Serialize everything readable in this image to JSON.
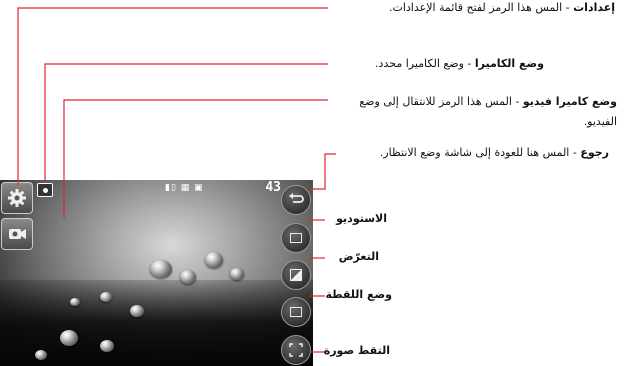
{
  "callouts": {
    "settings": {
      "bold": "إعدادات",
      "text": " - المس هذا الرمز لفتح قائمة الإعدادات."
    },
    "camera_mode": {
      "bold": "وضع الكاميرا",
      "text": " - وضع الكاميرا محدد."
    },
    "video_mode": {
      "bold": "وضع كاميرا فيديو",
      "text": " - المس هذا الرمز للانتقال إلى وضع الفيديو."
    },
    "back": {
      "bold": "رجوع",
      "text": " - المس هنا للعودة إلى شاشة وضع الانتظار."
    },
    "studio": {
      "bold": "الاستوديو",
      "text": ""
    },
    "exposure": {
      "bold": "التعرّض",
      "text": ""
    },
    "shot_mode": {
      "bold": "وضع اللقطة",
      "text": ""
    },
    "capture": {
      "bold": "التقط صورة",
      "text": ""
    }
  },
  "screen": {
    "counter": "43",
    "status": "▮▯ ▦ ▣"
  },
  "colors": {
    "callout_line": "#e2262b"
  }
}
